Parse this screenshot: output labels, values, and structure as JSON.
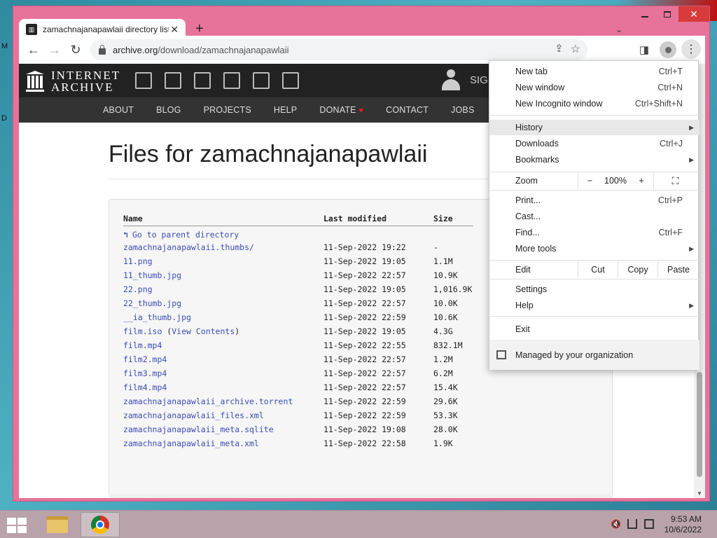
{
  "browser": {
    "tab_title": "zamachnajanapawlaii directory listing",
    "new_tab_symbol": "+",
    "url_host": "archive.org",
    "url_path": "/download/zamachnajanapawlaii"
  },
  "site": {
    "logo_line1": "INTERNET",
    "logo_line2": "ARCHIVE",
    "sign_in": "SIGN",
    "nav": [
      "ABOUT",
      "BLOG",
      "PROJECTS",
      "HELP",
      "DONATE",
      "CONTACT",
      "JOBS"
    ]
  },
  "page": {
    "title": "Files for zamachnajanapawlaii",
    "headers": {
      "name": "Name",
      "modified": "Last modified",
      "size": "Size"
    },
    "parent_link": "Go to parent directory",
    "files": [
      {
        "name": "zamachnajanapawlaii.thumbs/",
        "modified": "11-Sep-2022 19:22",
        "size": "-"
      },
      {
        "name": "11.png",
        "modified": "11-Sep-2022 19:05",
        "size": "1.1M"
      },
      {
        "name": "11_thumb.jpg",
        "modified": "11-Sep-2022 22:57",
        "size": "10.9K"
      },
      {
        "name": "22.png",
        "modified": "11-Sep-2022 19:05",
        "size": "1,016.9K"
      },
      {
        "name": "22_thumb.jpg",
        "modified": "11-Sep-2022 22:57",
        "size": "10.0K"
      },
      {
        "name": "__ia_thumb.jpg",
        "modified": "11-Sep-2022 22:59",
        "size": "10.6K"
      },
      {
        "name": "film.iso",
        "extra": "View Contents",
        "modified": "11-Sep-2022 19:05",
        "size": "4.3G"
      },
      {
        "name": "film.mp4",
        "modified": "11-Sep-2022 22:55",
        "size": "832.1M"
      },
      {
        "name": "film2.mp4",
        "modified": "11-Sep-2022 22:57",
        "size": "1.2M"
      },
      {
        "name": "film3.mp4",
        "modified": "11-Sep-2022 22:57",
        "size": "6.2M"
      },
      {
        "name": "film4.mp4",
        "modified": "11-Sep-2022 22:57",
        "size": "15.4K"
      },
      {
        "name": "zamachnajanapawlaii_archive.torrent",
        "modified": "11-Sep-2022 22:59",
        "size": "29.6K"
      },
      {
        "name": "zamachnajanapawlaii_files.xml",
        "modified": "11-Sep-2022 22:59",
        "size": "53.3K"
      },
      {
        "name": "zamachnajanapawlaii_meta.sqlite",
        "modified": "11-Sep-2022 19:08",
        "size": "28.0K"
      },
      {
        "name": "zamachnajanapawlaii_meta.xml",
        "modified": "11-Sep-2022 22:58",
        "size": "1.9K"
      }
    ]
  },
  "menu": {
    "new_tab": {
      "label": "New tab",
      "shortcut": "Ctrl+T"
    },
    "new_window": {
      "label": "New window",
      "shortcut": "Ctrl+N"
    },
    "incognito": {
      "label": "New Incognito window",
      "shortcut": "Ctrl+Shift+N"
    },
    "history": {
      "label": "History"
    },
    "downloads": {
      "label": "Downloads",
      "shortcut": "Ctrl+J"
    },
    "bookmarks": {
      "label": "Bookmarks"
    },
    "zoom": {
      "label": "Zoom",
      "minus": "−",
      "value": "100%",
      "plus": "+"
    },
    "print": {
      "label": "Print...",
      "shortcut": "Ctrl+P"
    },
    "cast": {
      "label": "Cast..."
    },
    "find": {
      "label": "Find...",
      "shortcut": "Ctrl+F"
    },
    "more_tools": {
      "label": "More tools"
    },
    "edit": {
      "label": "Edit",
      "cut": "Cut",
      "copy": "Copy",
      "paste": "Paste"
    },
    "settings": {
      "label": "Settings"
    },
    "help": {
      "label": "Help"
    },
    "exit": {
      "label": "Exit"
    },
    "managed": "Managed by your organization"
  },
  "taskbar": {
    "time": "9:53 AM",
    "date": "10/6/2022"
  },
  "desktop": {
    "left_letters": [
      "M",
      "D"
    ]
  }
}
